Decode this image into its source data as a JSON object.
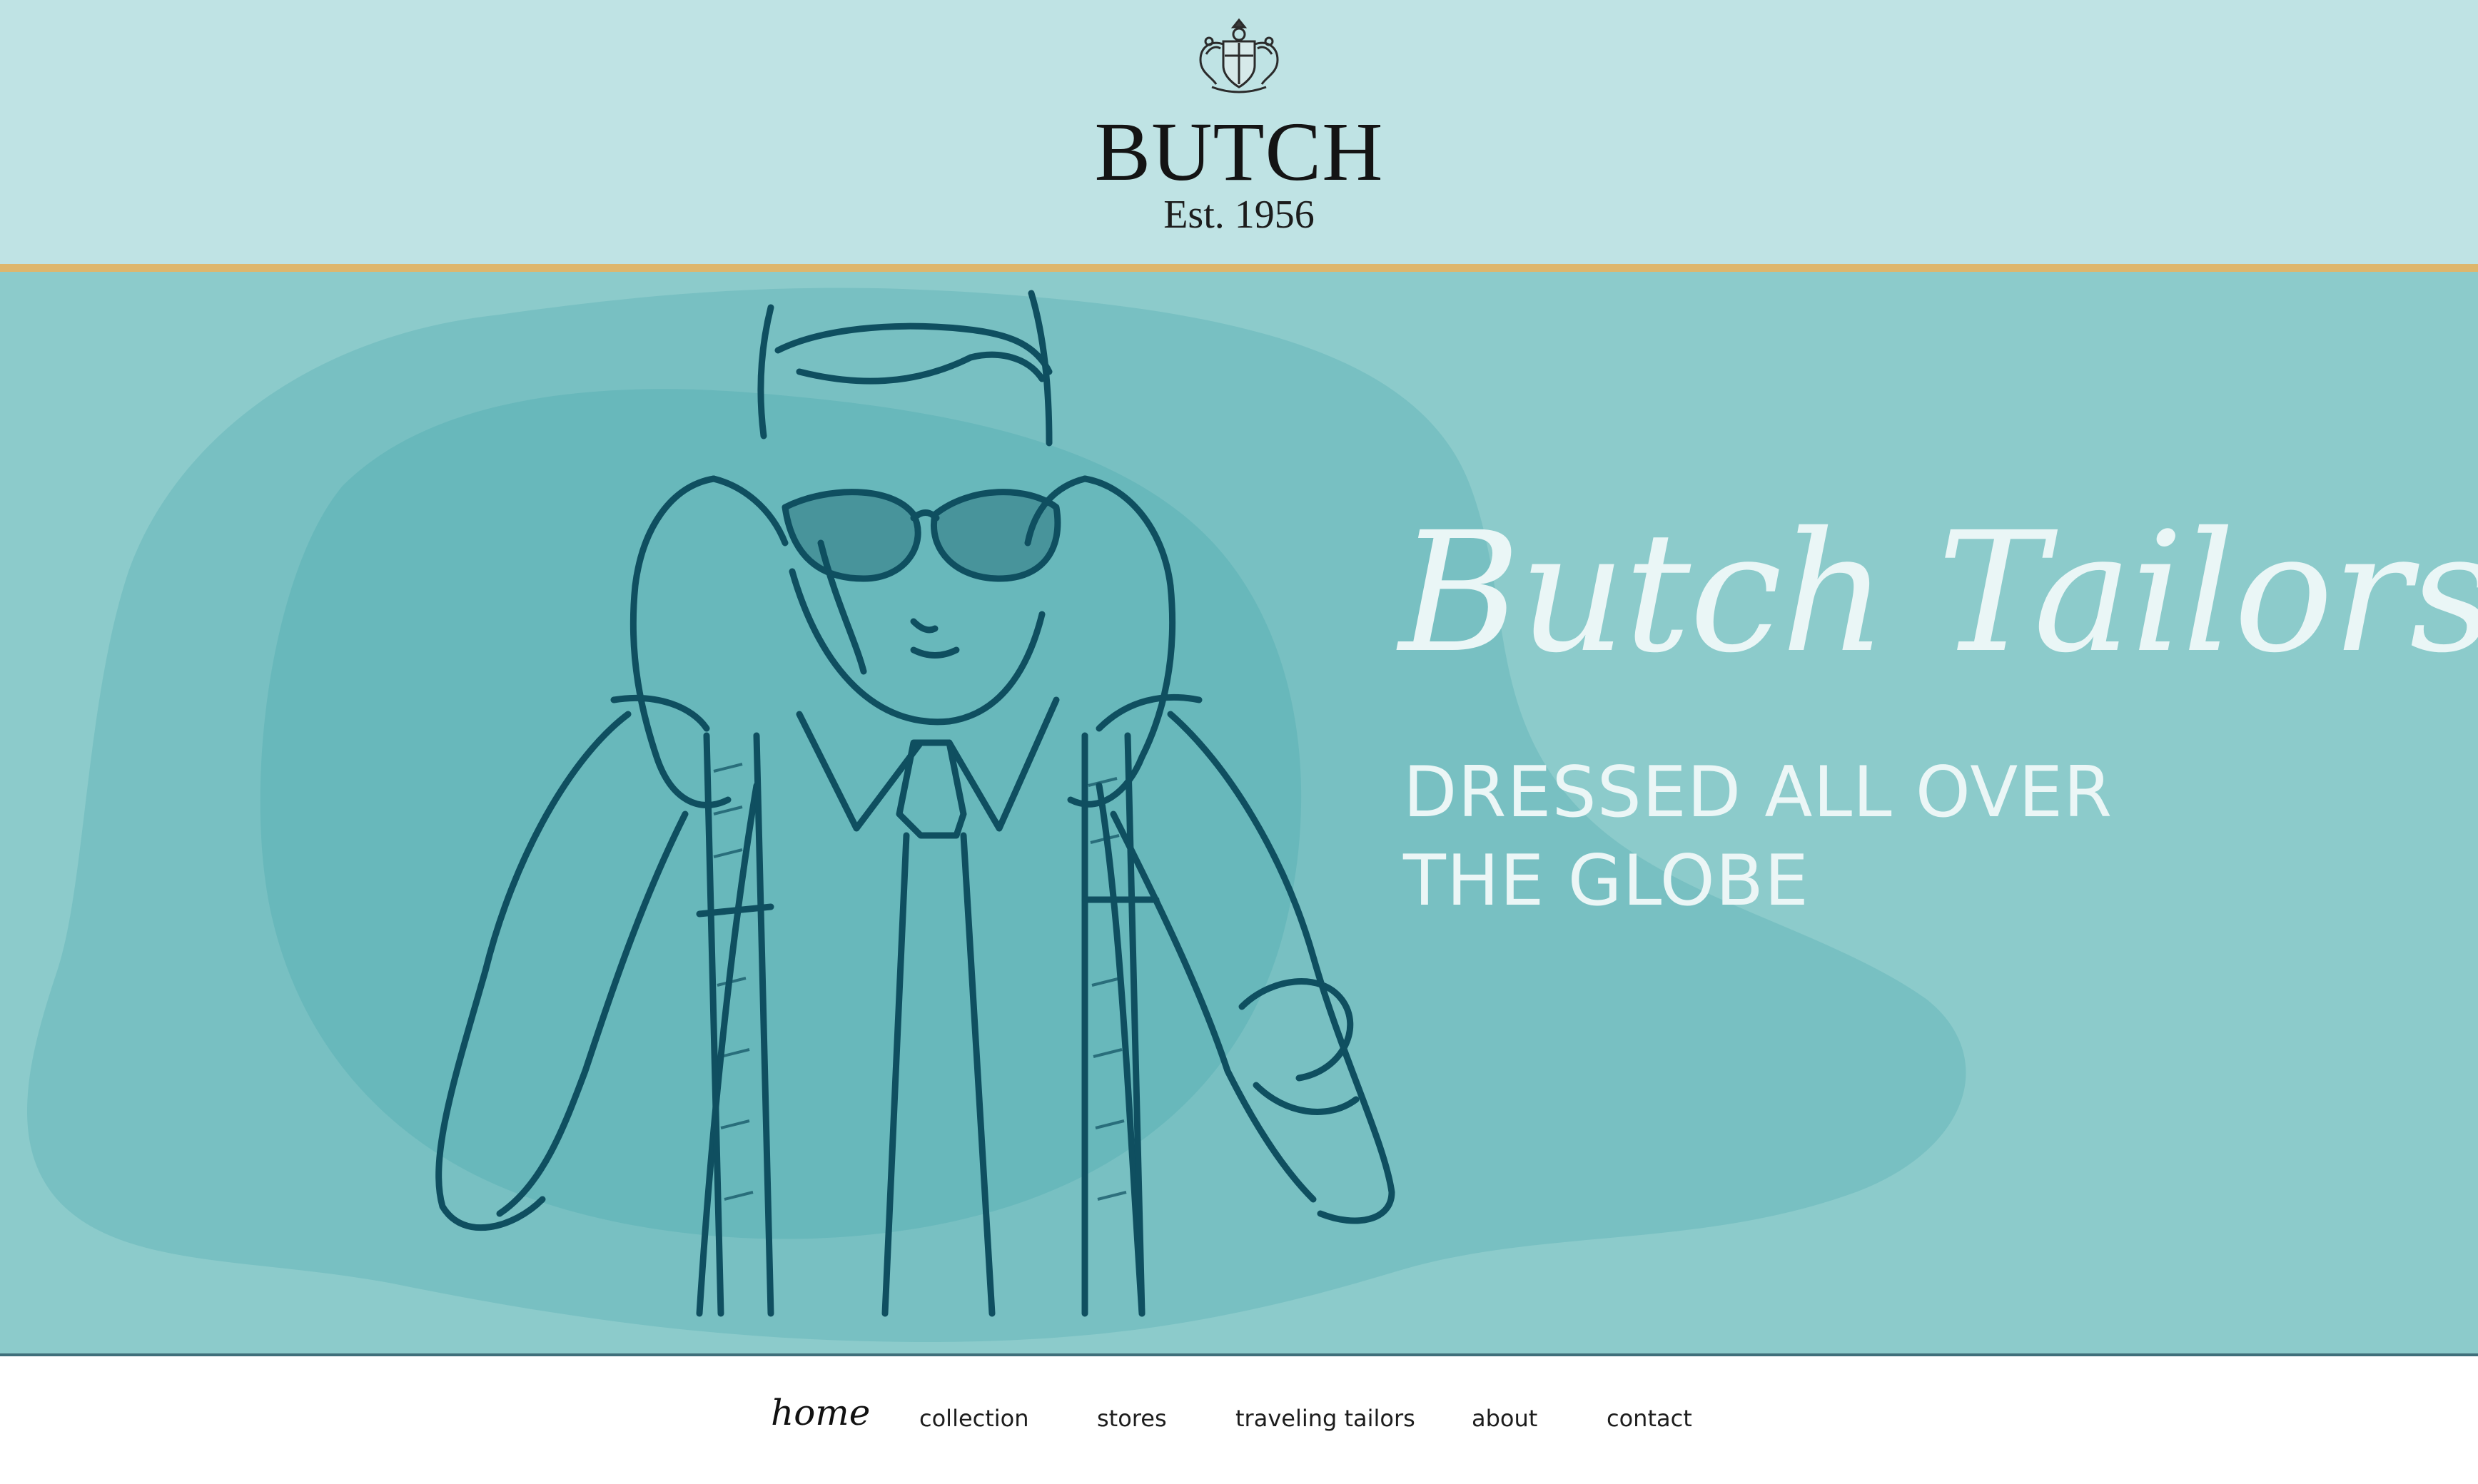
{
  "brand": {
    "name": "BUTCH",
    "established": "Est. 1956",
    "crest_icon": "crest-icon"
  },
  "hero": {
    "script_title": "Butch Tailors",
    "tagline_line1": "DRESSED ALL OVER",
    "tagline_line2": "THE GLOBE",
    "illustration": "man-in-suit-illustration"
  },
  "nav": {
    "items": [
      {
        "label": "home",
        "active": true
      },
      {
        "label": "collection",
        "active": false
      },
      {
        "label": "stores",
        "active": false
      },
      {
        "label": "traveling tailors",
        "active": false
      },
      {
        "label": "about",
        "active": false
      },
      {
        "label": "contact",
        "active": false
      }
    ]
  },
  "colors": {
    "header_bg": "#bfe3e4",
    "accent_gold": "#deb66c",
    "hero_bg": "#8ccbcb",
    "sketch_ink": "#0f4f60",
    "hero_text": "#eaf6f6"
  }
}
